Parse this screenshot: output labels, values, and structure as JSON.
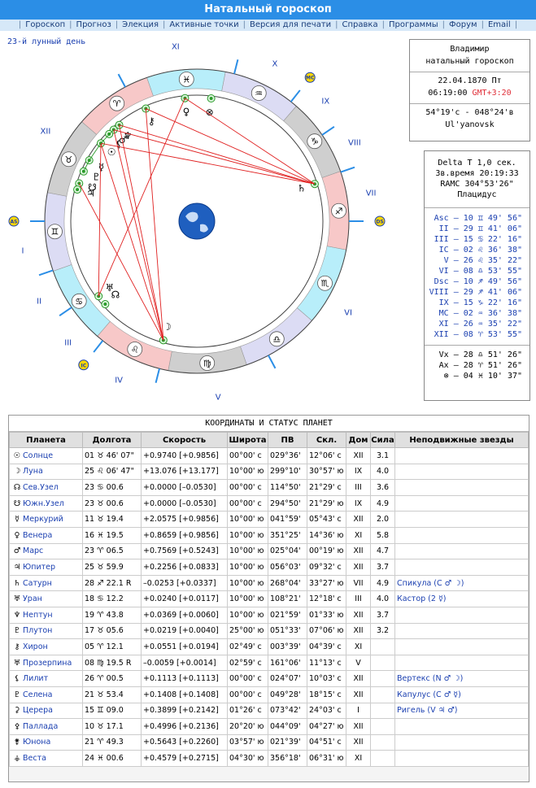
{
  "header": {
    "title": "Натальный гороскоп"
  },
  "nav": [
    "Гороскоп",
    "Прогноз",
    "Элекция",
    "Активные точки",
    "Версия для печати",
    "Справка",
    "Программы",
    "Форум",
    "Email"
  ],
  "lunar_day": "23-й лунный день",
  "info": {
    "name": "Владимир",
    "type": "натальный гороскоп",
    "date": "22.04.1870 Пт",
    "time": "06:19:00",
    "gmt": "GMT+3:20",
    "coords": "54°19'с - 048°24'в",
    "place": "Ul'yanovsk"
  },
  "extra": {
    "delta_t": "Delta T   1,0 сек.",
    "sidereal": "Зв.время 20:19:33",
    "ramc": "RAMC 304°53'26\"",
    "system": "Плацидус",
    "cusps": [
      "Asc – 10 ♊ 49' 56\"",
      "II – 29 ♊ 41' 06\"",
      "III – 15 ♋ 22' 16\"",
      "IC – 02 ♌ 36' 38\"",
      "V – 26 ♌ 35' 22\"",
      "VI – 08 ♎ 53' 55\"",
      "Dsc – 10 ♐ 49' 56\"",
      "VIII – 29 ♐ 41' 06\"",
      "IX – 15 ♑ 22' 16\"",
      "MC – 02 ♒ 36' 38\"",
      "XI – 26 ♒ 35' 22\"",
      "XII – 08 ♈ 53' 55\""
    ],
    "points": [
      "Vx – 28 ♎ 51' 26\"",
      "Ax – 28 ♈ 51' 26\"",
      "⊗ – 04 ♓ 10' 37\""
    ]
  },
  "wheel": {
    "house_labels": [
      "I",
      "II",
      "III",
      "IV",
      "V",
      "VI",
      "VII",
      "VIII",
      "IX",
      "X",
      "XI",
      "XII"
    ],
    "markers": {
      "asc": "AS",
      "dsc": "DS",
      "mc": "MC",
      "ic": "IC"
    },
    "colors": {
      "fire": "#f7c8c8",
      "air": "#dcdcf4",
      "water": "#b8eefa",
      "earth": "#cfcfcf",
      "accent": "#2b8ee6",
      "aspect_red": "#e02020",
      "marker": "#ffd700"
    }
  },
  "table": {
    "title": "КООРДИНАТЫ И СТАТУС ПЛАНЕТ",
    "headers": [
      "Планета",
      "Долгота",
      "Скорость",
      "Широта",
      "ПВ",
      "Скл.",
      "Дом",
      "Сила",
      "Неподвижные звезды"
    ],
    "rows": [
      {
        "g": "☉",
        "name": "Солнце",
        "lon": "01 ♉ 46' 07\"",
        "speed": "+0.9740  [+0.9856]",
        "lat": "00°00' с",
        "ra": "029°36'",
        "dec": "12°06' с",
        "house": "XII",
        "power": "3.1",
        "star": ""
      },
      {
        "g": "☽",
        "name": "Луна",
        "lon": "25 ♌ 06' 47\"",
        "speed": "+13.076  [+13.177]",
        "lat": "10°00' ю",
        "ra": "299°10'",
        "dec": "30°57' ю",
        "house": "IX",
        "power": "4.0",
        "star": ""
      },
      {
        "g": "☊",
        "name": "Сев.Узел",
        "lon": "23 ♋ 00.6",
        "speed": "+0.0000  [–0.0530]",
        "lat": "00°00' с",
        "ra": "114°50'",
        "dec": "21°29' с",
        "house": "III",
        "power": "3.6",
        "star": ""
      },
      {
        "g": "☋",
        "name": "Южн.Узел",
        "lon": "23 ♉ 00.6",
        "speed": "+0.0000  [–0.0530]",
        "lat": "00°00' с",
        "ra": "294°50'",
        "dec": "21°29' ю",
        "house": "IX",
        "power": "4.9",
        "star": ""
      },
      {
        "g": "☿",
        "name": "Меркурий",
        "lon": "11 ♉ 19.4",
        "speed": "+2.0575  [+0.9856]",
        "lat": "10°00' ю",
        "ra": "041°59'",
        "dec": "05°43' с",
        "house": "XII",
        "power": "2.0",
        "star": ""
      },
      {
        "g": "♀",
        "name": "Венера",
        "lon": "16 ♓ 19.5",
        "speed": "+0.8659  [+0.9856]",
        "lat": "10°00' ю",
        "ra": "351°25'",
        "dec": "14°36' ю",
        "house": "XI",
        "power": "5.8",
        "star": ""
      },
      {
        "g": "♂",
        "name": "Марс",
        "lon": "23 ♈ 06.5",
        "speed": "+0.7569  [+0.5243]",
        "lat": "10°00' ю",
        "ra": "025°04'",
        "dec": "00°19' ю",
        "house": "XII",
        "power": "4.7",
        "star": ""
      },
      {
        "g": "♃",
        "name": "Юпитер",
        "lon": "25 ♉ 59.9",
        "speed": "+0.2256  [+0.0833]",
        "lat": "10°00' ю",
        "ra": "056°03'",
        "dec": "09°32' с",
        "house": "XII",
        "power": "3.7",
        "star": ""
      },
      {
        "g": "♄",
        "name": "Сатурн",
        "lon": "28 ♐ 22.1  R",
        "speed": "–0.0253  [+0.0337]",
        "lat": "10°00' ю",
        "ra": "268°04'",
        "dec": "33°27' ю",
        "house": "VII",
        "power": "4.9",
        "star": "Спикула (С ♂ ☽)"
      },
      {
        "g": "♅",
        "name": "Уран",
        "lon": "18 ♋ 12.2",
        "speed": "+0.0240  [+0.0117]",
        "lat": "10°00' ю",
        "ra": "108°21'",
        "dec": "12°18' с",
        "house": "III",
        "power": "4.0",
        "star": "Кастор (2 ☿)"
      },
      {
        "g": "♆",
        "name": "Нептун",
        "lon": "19 ♈ 43.8",
        "speed": "+0.0369  [+0.0060]",
        "lat": "10°00' ю",
        "ra": "021°59'",
        "dec": "01°33' ю",
        "house": "XII",
        "power": "3.7",
        "star": ""
      },
      {
        "g": "♇",
        "name": "Плутон",
        "lon": "17 ♉ 05.6",
        "speed": "+0.0219  [+0.0040]",
        "lat": "25°00' ю",
        "ra": "051°33'",
        "dec": "07°06' ю",
        "house": "XII",
        "power": "3.2",
        "star": ""
      },
      {
        "g": "⚷",
        "name": "Хирон",
        "lon": "05 ♈ 12.1",
        "speed": "+0.0551  [+0.0194]",
        "lat": "02°49' с",
        "ra": "003°39'",
        "dec": "04°39' с",
        "house": "XI",
        "power": "",
        "star": ""
      },
      {
        "g": "♅",
        "name": "Прозерпина",
        "lon": "08 ♍ 19.5  R",
        "speed": "–0.0059  [+0.0014]",
        "lat": "02°59' с",
        "ra": "161°06'",
        "dec": "11°13' с",
        "house": "V",
        "power": "",
        "star": ""
      },
      {
        "g": "⚸",
        "name": "Лилит",
        "lon": "26 ♈ 00.5",
        "speed": "+0.1113  [+0.1113]",
        "lat": "00°00' с",
        "ra": "024°07'",
        "dec": "10°03' с",
        "house": "XII",
        "power": "",
        "star": "Вертекс (N ♂ ☽)"
      },
      {
        "g": "♇",
        "name": "Селена",
        "lon": "21 ♉ 53.4",
        "speed": "+0.1408  [+0.1408]",
        "lat": "00°00' с",
        "ra": "049°28'",
        "dec": "18°15' с",
        "house": "XII",
        "power": "",
        "star": "Капулус (С ♂ ☿)"
      },
      {
        "g": "⚳",
        "name": "Церера",
        "lon": "15 ♊ 09.0",
        "speed": "+0.3899  [+0.2142]",
        "lat": "01°26' с",
        "ra": "073°42'",
        "dec": "24°03' с",
        "house": "I",
        "power": "",
        "star": "Ригель (V ♃ ♂)"
      },
      {
        "g": "⚴",
        "name": "Паллада",
        "lon": "10 ♉ 17.1",
        "speed": "+0.4996  [+0.2136]",
        "lat": "20°20' ю",
        "ra": "044°09'",
        "dec": "04°27' ю",
        "house": "XII",
        "power": "",
        "star": ""
      },
      {
        "g": "⚵",
        "name": "Юнона",
        "lon": "21 ♈ 49.3",
        "speed": "+0.5643  [+0.2260]",
        "lat": "03°57' ю",
        "ra": "021°39'",
        "dec": "04°51' с",
        "house": "XII",
        "power": "",
        "star": ""
      },
      {
        "g": "⚶",
        "name": "Веста",
        "lon": "24 ♓ 00.6",
        "speed": "+0.4579  [+0.2715]",
        "lat": "04°30' ю",
        "ra": "356°18'",
        "dec": "06°31' ю",
        "house": "XI",
        "power": "",
        "star": ""
      }
    ]
  }
}
